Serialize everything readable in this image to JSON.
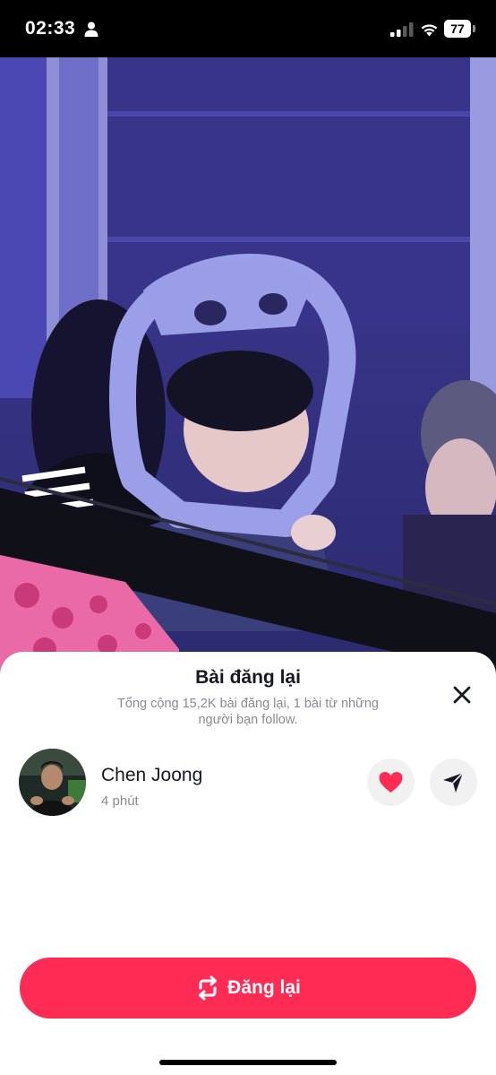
{
  "status_bar": {
    "time": "02:33",
    "battery_level": "77",
    "battery_fraction": 0.77,
    "icons": [
      "person-icon",
      "signal-icon",
      "wifi-icon",
      "battery-icon"
    ]
  },
  "sheet": {
    "title": "Bài đăng lại",
    "subtitle": "Tổng cộng 15,2K bài đăng lại, 1 bài từ những người bạn follow.",
    "close_icon": "close-icon"
  },
  "reposter": {
    "name": "Chen Joong",
    "time_ago": "4 phút",
    "like_icon": "heart-icon",
    "share_icon": "send-icon"
  },
  "repost_button": {
    "label": "Đăng lại",
    "icon": "repost-icon"
  },
  "colors": {
    "accent": "#fe2c55",
    "heart": "#fe2c55",
    "sheet_bg": "#ffffff",
    "text_primary": "#161823",
    "text_secondary": "#8a8b91"
  }
}
